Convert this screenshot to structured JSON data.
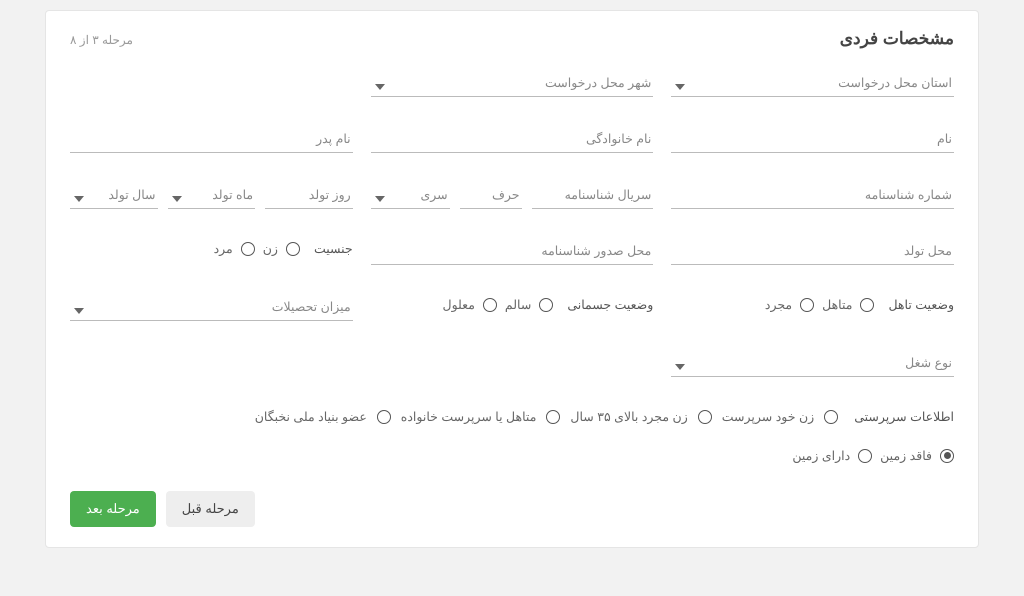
{
  "header": {
    "title": "مشخصات فردی",
    "step": "مرحله ۳ از ۸"
  },
  "fields": {
    "province": "استان محل درخواست",
    "city": "شهر محل درخواست",
    "first_name": "نام",
    "last_name": "نام خانوادگی",
    "father_name": "نام پدر",
    "id_number": "شماره شناسنامه",
    "id_serial": "سریال شناسنامه",
    "letter": "حرف",
    "seri": "سری",
    "birth_day": "روز تولد",
    "birth_month": "ماه تولد",
    "birth_year": "سال تولد",
    "birth_place": "محل تولد",
    "id_issue_place": "محل صدور شناسنامه",
    "gender_label": "جنسیت",
    "gender_female": "زن",
    "gender_male": "مرد",
    "marital_label": "وضعیت تاهل",
    "marital_married": "متاهل",
    "marital_single": "مجرد",
    "physical_label": "وضعیت جسمانی",
    "physical_healthy": "سالم",
    "physical_disabled": "معلول",
    "education": "میزان تحصیلات",
    "job_type": "نوع شغل",
    "supervision_label": "اطلاعات سرپرستی",
    "sup_self": "زن خود سرپرست",
    "sup_over35": "زن مجرد بالای ۳۵ سال",
    "sup_family": "متاهل یا سرپرست خانواده",
    "sup_elite": "عضو بنیاد ملی نخبگان",
    "land_none": "فاقد زمین",
    "land_has": "دارای زمین"
  },
  "buttons": {
    "prev": "مرحله قبل",
    "next": "مرحله بعد"
  },
  "state": {
    "land_selected": "none"
  }
}
